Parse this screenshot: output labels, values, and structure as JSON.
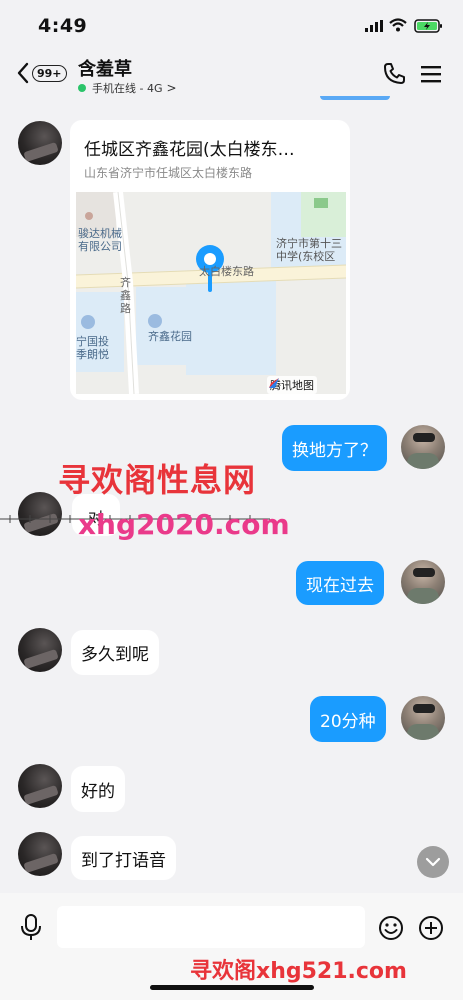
{
  "status": {
    "time": "4:49"
  },
  "header": {
    "back_count": "99+",
    "contact_name": "含羞草",
    "online_status": "手机在线 - 4G",
    "online_chevron": ">"
  },
  "location": {
    "title": "任城区齐鑫花园(太白楼东…",
    "address": "山东省济宁市任城区太白楼东路",
    "map_labels": {
      "company": "骏达机械\n有限公司",
      "school": "济宁市第十三\n中学(东校区",
      "road_taibai": "太白楼东路",
      "road_qixin": "齐\n鑫\n路",
      "garden": "齐鑫花园",
      "building": "宁国投\n季朗悦"
    },
    "watermark": "腾讯地图"
  },
  "messages": [
    {
      "side": "right",
      "text": "换地方了？"
    },
    {
      "side": "left",
      "text": "对"
    },
    {
      "side": "right",
      "text": "现在过去"
    },
    {
      "side": "left",
      "text": "多久到呢"
    },
    {
      "side": "right",
      "text": "20分种"
    },
    {
      "side": "left",
      "text": "好的"
    },
    {
      "side": "left",
      "text": "到了打语音"
    }
  ],
  "watermarks": {
    "top_cn": "寻欢阁性息网",
    "top_url": "xhg2020.com",
    "bottom": "寻欢阁xhg521.com"
  },
  "input": {
    "value": "",
    "placeholder": ""
  },
  "colors": {
    "bubble_blue": "#1a9cff",
    "online_green": "#2bc46a",
    "battery_green": "#4cd964"
  },
  "icons": [
    "back-chevron-icon",
    "phone-icon",
    "menu-icon",
    "map-pin-icon",
    "microphone-icon",
    "emoji-icon",
    "plus-icon",
    "chevron-down-icon"
  ]
}
